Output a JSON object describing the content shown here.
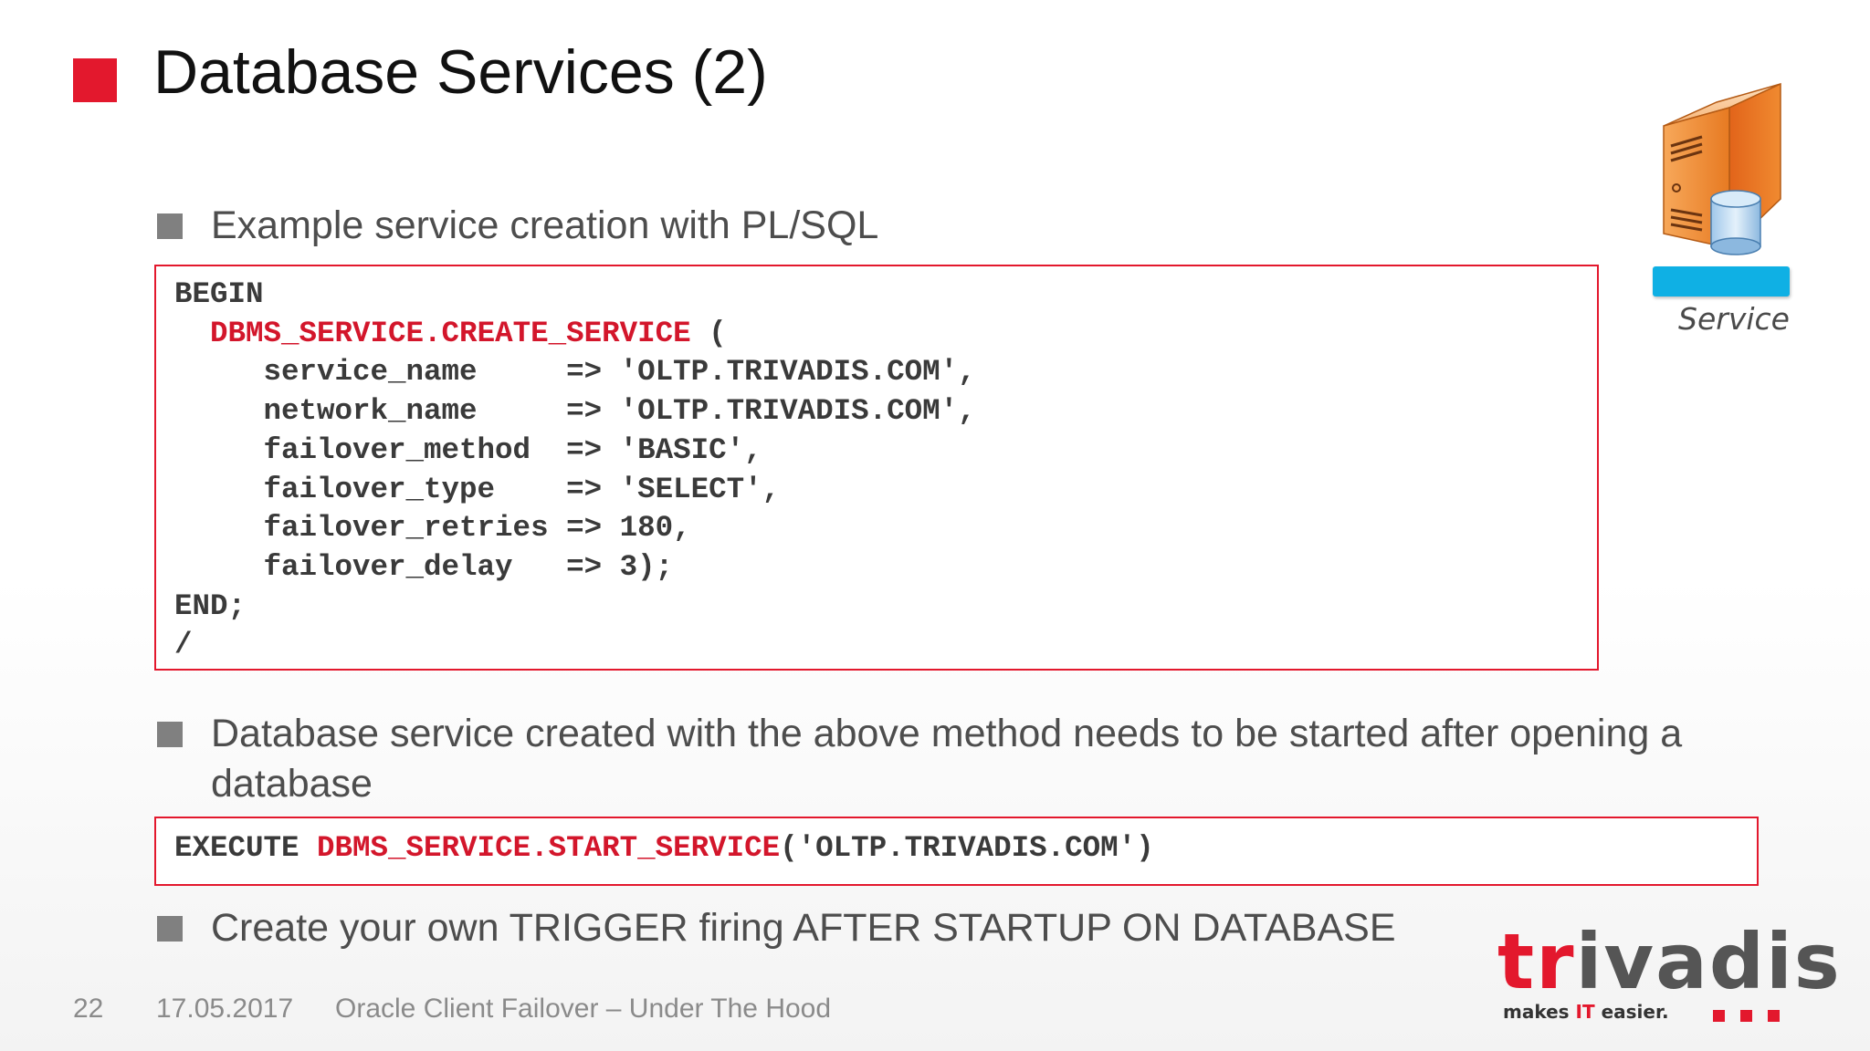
{
  "slide": {
    "title": "Database Services (2)"
  },
  "bullets": [
    {
      "text": "Example service creation with PL/SQL"
    },
    {
      "text": "Database service created with the above method needs to be started after opening a database"
    },
    {
      "text": "Create your own TRIGGER firing AFTER STARTUP ON DATABASE"
    }
  ],
  "code1": {
    "lines": [
      {
        "plain": "BEGIN",
        "red": "",
        "tail": ""
      },
      {
        "plain": "  ",
        "red": "DBMS_SERVICE.CREATE_SERVICE",
        "tail": " ("
      },
      {
        "plain": "     service_name     => 'OLTP.TRIVADIS.COM',",
        "red": "",
        "tail": ""
      },
      {
        "plain": "     network_name     => 'OLTP.TRIVADIS.COM',",
        "red": "",
        "tail": ""
      },
      {
        "plain": "     failover_method  => 'BASIC',",
        "red": "",
        "tail": ""
      },
      {
        "plain": "     failover_type    => 'SELECT',",
        "red": "",
        "tail": ""
      },
      {
        "plain": "     failover_retries => 180,",
        "red": "",
        "tail": ""
      },
      {
        "plain": "     failover_delay   => 3);",
        "red": "",
        "tail": ""
      },
      {
        "plain": "END;",
        "red": "",
        "tail": ""
      },
      {
        "plain": "/",
        "red": "",
        "tail": ""
      }
    ]
  },
  "code2": {
    "prefix": "EXECUTE ",
    "red": "DBMS_SERVICE.START_SERVICE",
    "suffix": "('OLTP.TRIVADIS.COM')"
  },
  "icon": {
    "name": "server-database-icon",
    "label": "Service"
  },
  "footer": {
    "page_number": "22",
    "date": "17.05.2017",
    "presentation_title": "Oracle Client Failover – Under The Hood"
  },
  "logo": {
    "word_red": "tr",
    "word_rest": "ivadis",
    "tagline_start": "makes ",
    "tagline_it": "IT",
    "tagline_end": " easier."
  },
  "colors": {
    "accent_red": "#e3182d",
    "code_red": "#d3162b",
    "bullet_gray": "#808080",
    "service_blue": "#0fb0e4",
    "server_orange": "#e8781c"
  }
}
